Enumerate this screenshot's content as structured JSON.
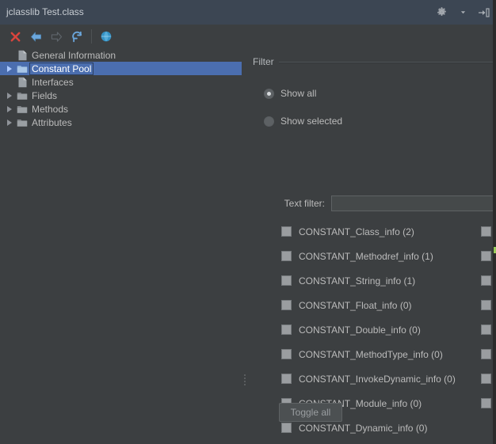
{
  "window": {
    "title": "jclasslib Test.class",
    "actions": [
      {
        "name": "settings-gear",
        "icon": "gear-icon",
        "label": "Settings"
      },
      {
        "name": "hide-tool-window",
        "icon": "hide-icon",
        "label": "Hide"
      }
    ]
  },
  "toolbar": {
    "buttons": [
      {
        "name": "close",
        "icon": "close-x-icon",
        "label": "Close",
        "color": "#d9453d"
      },
      {
        "name": "back",
        "icon": "arrow-left-icon",
        "label": "Back",
        "color": "#6eacde"
      },
      {
        "name": "forward",
        "icon": "arrow-right-icon",
        "label": "Forward",
        "color": "#5a6067"
      },
      {
        "name": "reload",
        "icon": "refresh-icon",
        "label": "Reload",
        "color": "#6eacde"
      },
      {
        "name": "browse",
        "icon": "globe-icon",
        "label": "Browse",
        "color": "#3592c4"
      }
    ]
  },
  "tree": {
    "items": [
      {
        "label": "General Information",
        "icon": "file-icon",
        "expandable": false,
        "selected": false
      },
      {
        "label": "Constant Pool",
        "icon": "folder-icon",
        "expandable": true,
        "selected": true
      },
      {
        "label": "Interfaces",
        "icon": "file-icon",
        "expandable": false,
        "selected": false
      },
      {
        "label": "Fields",
        "icon": "folder-icon",
        "expandable": true,
        "selected": false
      },
      {
        "label": "Methods",
        "icon": "folder-icon",
        "expandable": true,
        "selected": false
      },
      {
        "label": "Attributes",
        "icon": "folder-icon",
        "expandable": true,
        "selected": false
      }
    ]
  },
  "filter": {
    "title": "Filter",
    "radios": [
      {
        "label": "Show all",
        "checked": true
      },
      {
        "label": "Show selected",
        "checked": false
      }
    ],
    "text_filter": {
      "label": "Text filter:",
      "value": "",
      "placeholder": ""
    },
    "constants": [
      {
        "label": "CONSTANT_Class_info (2)",
        "checked": true
      },
      {
        "label": "CONSTANT_Methodref_info (1)",
        "checked": true
      },
      {
        "label": "CONSTANT_String_info (1)",
        "checked": true
      },
      {
        "label": "CONSTANT_Float_info (0)",
        "checked": true
      },
      {
        "label": "CONSTANT_Double_info (0)",
        "checked": true
      },
      {
        "label": "CONSTANT_MethodType_info (0)",
        "checked": true
      },
      {
        "label": "CONSTANT_InvokeDynamic_info (0)",
        "checked": true
      },
      {
        "label": "CONSTANT_Module_info (0)",
        "checked": true
      },
      {
        "label": "CONSTANT_Dynamic_info (0)",
        "checked": true
      }
    ],
    "toggle_all_label": "Toggle all"
  },
  "colors": {
    "panel_bg": "#3c3f41",
    "titlebar_bg": "#3c4653",
    "selection_blue": "#4b6eaf",
    "text": "#bbbbbb",
    "accent_green": "#9aca5c"
  }
}
